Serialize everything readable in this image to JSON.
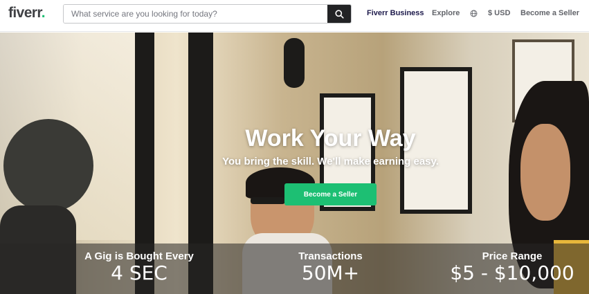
{
  "header": {
    "logo": "fiverr",
    "logo_dot": ".",
    "search_placeholder": "What service are you looking for today?",
    "nav": {
      "business": "Fiverr Business",
      "explore": "Explore",
      "currency": "$ USD",
      "become_seller": "Become a Seller"
    }
  },
  "hero": {
    "title": "Work Your Way",
    "subtitle": "You bring the skill. We'll make earning easy.",
    "cta_label": "Become a Seller"
  },
  "stats": [
    {
      "label": "A Gig is Bought Every",
      "value": "4 SEC"
    },
    {
      "label": "Transactions",
      "value": "50M+"
    },
    {
      "label": "Price Range",
      "value": "$5 - $10,000"
    }
  ],
  "colors": {
    "brand_green": "#1dbf73",
    "dark": "#222325",
    "business_navy": "#1d1a4b"
  },
  "icons": {
    "search": "search-icon",
    "globe": "globe-icon"
  }
}
